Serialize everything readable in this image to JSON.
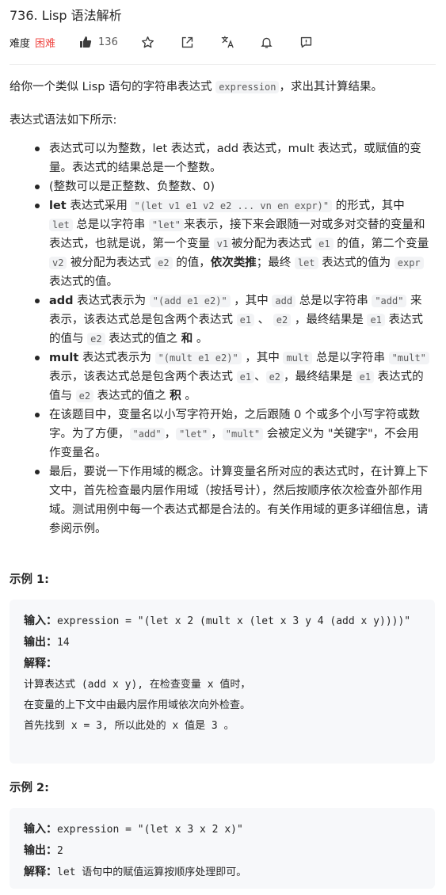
{
  "header": {
    "title": "736. Lisp 语法解析",
    "difficulty_label": "难度",
    "difficulty_value": "困难",
    "likes": "136"
  },
  "intro": {
    "p1_a": "给你一个类似 Lisp 语句的字符串表达式 ",
    "p1_code": "expression",
    "p1_b": "，求出其计算结果。",
    "p2": "表达式语法如下所示:"
  },
  "rules": {
    "r1": "表达式可以为整数，let 表达式，add 表达式，mult 表达式，或赋值的变量。表达式的结果总是一个整数。",
    "r2": "(整数可以是正整数、负整数、0)",
    "r3_a": "let",
    "r3_b": " 表达式采用 ",
    "r3_code": "\"(let v1 e1 v2 e2 ... vn en expr)\"",
    "r3_c": " 的形式，其中 ",
    "r3_code2": "let",
    "r3_d": " 总是以字符串 ",
    "r3_code3": "\"let\"",
    "r3_e": "来表示，接下来会跟随一对或多对交替的变量和表达式，也就是说，第一个变量 ",
    "r3_code4": "v1",
    "r3_f": "被分配为表达式 ",
    "r3_code5": "e1",
    "r3_g": " 的值，第二个变量 ",
    "r3_code6": "v2",
    "r3_h": " 被分配为表达式 ",
    "r3_code7": "e2",
    "r3_i": " 的值，",
    "r3_bold": "依次类推",
    "r3_j": "；最终 ",
    "r3_code8": "let",
    "r3_k": " 表达式的值为 ",
    "r3_code9": "expr",
    "r3_l": "表达式的值。",
    "r4_a": "add",
    "r4_b": " 表达式表示为 ",
    "r4_code": "\"(add e1 e2)\"",
    "r4_c": " ，其中 ",
    "r4_code2": "add",
    "r4_d": " 总是以字符串 ",
    "r4_code3": "\"add\"",
    "r4_e": " 来表示，该表达式总是包含两个表达式 ",
    "r4_code4": "e1",
    "r4_f": " 、 ",
    "r4_code5": "e2",
    "r4_g": " ，最终结果是 ",
    "r4_code6": "e1",
    "r4_h": " 表达式的值与 ",
    "r4_code7": "e2",
    "r4_i": " 表达式的值之 ",
    "r4_bold": "和",
    "r4_j": " 。",
    "r5_a": "mult",
    "r5_b": " 表达式表示为 ",
    "r5_code": "\"(mult e1 e2)\"",
    "r5_c": " ，其中 ",
    "r5_code2": "mult",
    "r5_d": " 总是以字符串 ",
    "r5_code3": "\"mult\"",
    "r5_e": " 表示，该表达式总是包含两个表达式 ",
    "r5_code4": "e1",
    "r5_f": "、",
    "r5_code5": "e2",
    "r5_g": "，最终结果是 ",
    "r5_code6": "e1",
    "r5_h": " 表达式的值与 ",
    "r5_code7": "e2",
    "r5_i": " 表达式的值之 ",
    "r5_bold": "积",
    "r5_j": " 。",
    "r6_a": "在该题目中，变量名以小写字符开始，之后跟随 0 个或多个小写字符或数字。为了方便，",
    "r6_code": "\"add\"",
    "r6_b": "，",
    "r6_code2": "\"let\"",
    "r6_c": "，",
    "r6_code3": "\"mult\"",
    "r6_d": " 会被定义为 \"关键字\"，不会用作变量名。",
    "r7": "最后，要说一下作用域的概念。计算变量名所对应的表达式时，在计算上下文中，首先检查最内层作用域（按括号计），然后按顺序依次检查外部作用域。测试用例中每一个表达式都是合法的。有关作用域的更多详细信息，请参阅示例。"
  },
  "example1": {
    "title": "示例 1:",
    "input_label": "输入：",
    "input_value": "expression = \"(let x 2 (mult x (let x 3 y 4 (add x y))))\"",
    "output_label": "输出：",
    "output_value": "14",
    "explain_label": "解释：",
    "explain_1": "计算表达式 (add x y), 在检查变量 x 值时，",
    "explain_2": "在变量的上下文中由最内层作用域依次向外检查。",
    "explain_3": "首先找到 x = 3, 所以此处的 x 值是 3 。"
  },
  "example2": {
    "title": "示例 2:",
    "input_label": "输入：",
    "input_value": "expression = \"(let x 3 x 2 x)\"",
    "output_label": "输出：",
    "output_value": "2",
    "explain_label": "解释：",
    "explain_value": "let 语句中的赋值运算按顺序处理即可。"
  },
  "icons": [
    "thumbs-up-icon",
    "star-icon",
    "share-icon",
    "translate-icon",
    "bell-icon",
    "feedback-icon"
  ]
}
